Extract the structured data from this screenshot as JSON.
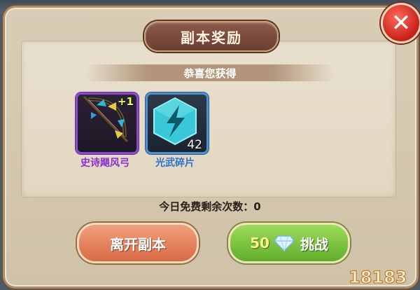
{
  "dialog": {
    "title": "副本奖励",
    "subtitle": "恭喜您获得",
    "close_label": "✕",
    "free_attempts_text": "今日免费剩余次数：0"
  },
  "rewards": [
    {
      "name": "史诗飓风弓",
      "badge": "+1",
      "icon": "bow-icon",
      "rarity_color": "#8a4cc9"
    },
    {
      "name": "光武碎片",
      "count": "42",
      "icon": "lightning-shard-icon",
      "rarity_color": "#4f8fd0"
    }
  ],
  "buttons": {
    "leave": "离开副本",
    "challenge_cost": "50",
    "challenge_label": "挑战",
    "challenge_icon": "diamond-icon"
  },
  "watermark": {
    "text": "18183"
  }
}
